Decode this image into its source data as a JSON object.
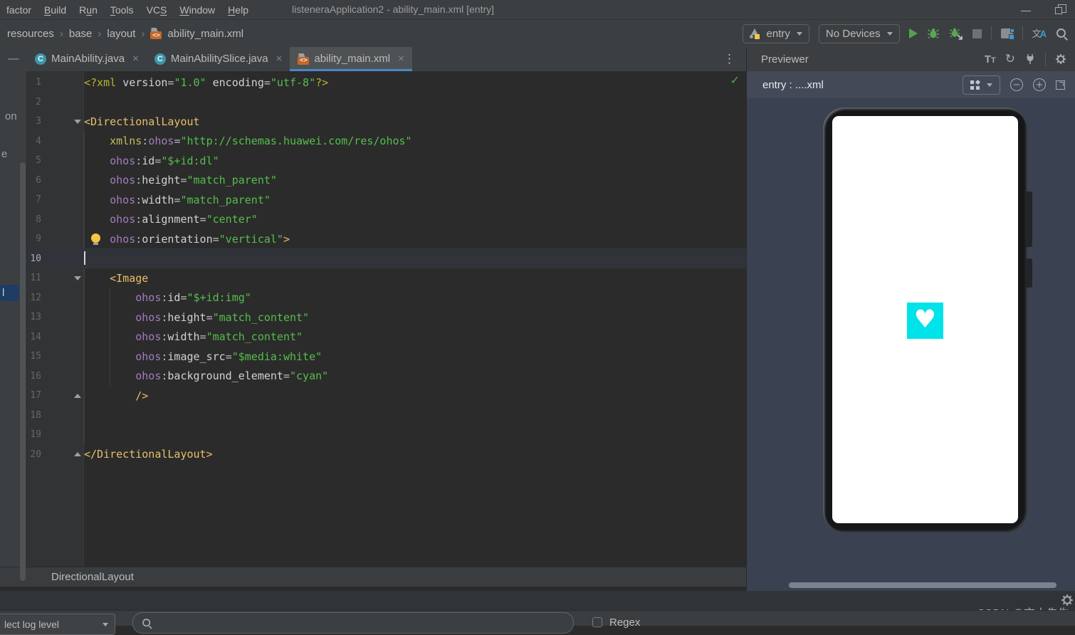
{
  "window": {
    "title": "listeneraApplication2 - ability_main.xml [entry]"
  },
  "menu": {
    "items": [
      {
        "label": "factor",
        "u": null
      },
      {
        "label": "Build",
        "u": 0
      },
      {
        "label": "Run",
        "u": 1
      },
      {
        "label": "Tools",
        "u": 0
      },
      {
        "label": "VCS",
        "u": 2
      },
      {
        "label": "Window",
        "u": 0
      },
      {
        "label": "Help",
        "u": 0
      }
    ]
  },
  "navbar": {
    "breadcrumbs": [
      "resources",
      "base",
      "layout"
    ],
    "file": "ability_main.xml",
    "run_config": "entry",
    "device": "No Devices"
  },
  "tabs": [
    {
      "label": "MainAbility.java",
      "icon": "java",
      "active": false
    },
    {
      "label": "MainAbilitySlice.java",
      "icon": "java",
      "active": false
    },
    {
      "label": "ability_main.xml",
      "icon": "xml",
      "active": true
    }
  ],
  "editor": {
    "breadcrumb": "DirectionalLayout",
    "lines": [
      {
        "n": 1,
        "t": [
          [
            "pi",
            "<?xml "
          ],
          [
            "attr",
            "version"
          ],
          [
            "eq",
            "="
          ],
          [
            "str",
            "\"1.0\""
          ],
          [
            "pl",
            " "
          ],
          [
            "attr",
            "encoding"
          ],
          [
            "eq",
            "="
          ],
          [
            "str",
            "\"utf-8\""
          ],
          [
            "pi",
            "?>"
          ]
        ]
      },
      {
        "n": 2,
        "t": []
      },
      {
        "n": 3,
        "fold": "open",
        "t": [
          [
            "tag",
            "<DirectionalLayout"
          ]
        ]
      },
      {
        "n": 4,
        "t": [
          [
            "pl",
            "    "
          ],
          [
            "kw",
            "xmlns"
          ],
          [
            "eq",
            ":"
          ],
          [
            "ns",
            "ohos"
          ],
          [
            "eq",
            "="
          ],
          [
            "str",
            "\"http://schemas.huawei.com/res/ohos\""
          ]
        ]
      },
      {
        "n": 5,
        "t": [
          [
            "pl",
            "    "
          ],
          [
            "ns",
            "ohos"
          ],
          [
            "eq",
            ":"
          ],
          [
            "attr",
            "id"
          ],
          [
            "eq",
            "="
          ],
          [
            "str",
            "\"$+id:dl\""
          ]
        ]
      },
      {
        "n": 6,
        "t": [
          [
            "pl",
            "    "
          ],
          [
            "ns",
            "ohos"
          ],
          [
            "eq",
            ":"
          ],
          [
            "attr",
            "height"
          ],
          [
            "eq",
            "="
          ],
          [
            "str",
            "\"match_parent\""
          ]
        ]
      },
      {
        "n": 7,
        "t": [
          [
            "pl",
            "    "
          ],
          [
            "ns",
            "ohos"
          ],
          [
            "eq",
            ":"
          ],
          [
            "attr",
            "width"
          ],
          [
            "eq",
            "="
          ],
          [
            "str",
            "\"match_parent\""
          ]
        ]
      },
      {
        "n": 8,
        "t": [
          [
            "pl",
            "    "
          ],
          [
            "ns",
            "ohos"
          ],
          [
            "eq",
            ":"
          ],
          [
            "attr",
            "alignment"
          ],
          [
            "eq",
            "="
          ],
          [
            "str",
            "\"center\""
          ]
        ]
      },
      {
        "n": 9,
        "bulb": true,
        "t": [
          [
            "pl",
            "    "
          ],
          [
            "ns",
            "ohos"
          ],
          [
            "eq",
            ":"
          ],
          [
            "attr",
            "orientation"
          ],
          [
            "eq",
            "="
          ],
          [
            "str",
            "\"vertical\""
          ],
          [
            "tag",
            ">"
          ]
        ]
      },
      {
        "n": 10,
        "current": true,
        "caret": true,
        "t": []
      },
      {
        "n": 11,
        "fold": "open",
        "t": [
          [
            "pl",
            "    "
          ],
          [
            "tag",
            "<Image"
          ]
        ]
      },
      {
        "n": 12,
        "t": [
          [
            "pl",
            "        "
          ],
          [
            "ns",
            "ohos"
          ],
          [
            "eq",
            ":"
          ],
          [
            "attr",
            "id"
          ],
          [
            "eq",
            "="
          ],
          [
            "str",
            "\"$+id:img\""
          ]
        ]
      },
      {
        "n": 13,
        "t": [
          [
            "pl",
            "        "
          ],
          [
            "ns",
            "ohos"
          ],
          [
            "eq",
            ":"
          ],
          [
            "attr",
            "height"
          ],
          [
            "eq",
            "="
          ],
          [
            "str",
            "\"match_content\""
          ]
        ]
      },
      {
        "n": 14,
        "t": [
          [
            "pl",
            "        "
          ],
          [
            "ns",
            "ohos"
          ],
          [
            "eq",
            ":"
          ],
          [
            "attr",
            "width"
          ],
          [
            "eq",
            "="
          ],
          [
            "str",
            "\"match_content\""
          ]
        ]
      },
      {
        "n": 15,
        "t": [
          [
            "pl",
            "        "
          ],
          [
            "ns",
            "ohos"
          ],
          [
            "eq",
            ":"
          ],
          [
            "attr",
            "image_src"
          ],
          [
            "eq",
            "="
          ],
          [
            "str",
            "\"$media:white\""
          ]
        ]
      },
      {
        "n": 16,
        "t": [
          [
            "pl",
            "        "
          ],
          [
            "ns",
            "ohos"
          ],
          [
            "eq",
            ":"
          ],
          [
            "attr",
            "background_element"
          ],
          [
            "eq",
            "="
          ],
          [
            "str",
            "\"cyan\""
          ]
        ]
      },
      {
        "n": 17,
        "fold": "close",
        "t": [
          [
            "pl",
            "        "
          ],
          [
            "tag",
            "/>"
          ]
        ]
      },
      {
        "n": 18,
        "t": []
      },
      {
        "n": 19,
        "t": []
      },
      {
        "n": 20,
        "fold": "close",
        "t": [
          [
            "tag",
            "</DirectionalLayout>"
          ]
        ]
      }
    ]
  },
  "sliver": {
    "fragments": [
      "on",
      "e"
    ],
    "selected_fragment": "l"
  },
  "previewer": {
    "panel_title": "Previewer",
    "target": "entry : ....xml"
  },
  "bottom": {
    "log_level": "lect log level",
    "regex": "Regex"
  },
  "watermark": "CSDN @吉士先生",
  "icons": {
    "kebab": "⋮",
    "tab_strip_hide": "—",
    "minimize": "—",
    "close_tab": "×",
    "check": "✓",
    "refresh": "↻",
    "heart": "♥",
    "crumb_sep": "›",
    "xml_glyph": "<>",
    "java_glyph": "C",
    "zoom_in": "+",
    "zoom_out": "−",
    "font_big": "T",
    "font_small": "T",
    "translate_zh": "文",
    "translate_en": "A"
  },
  "colors": {
    "tab_accent": "#4A88C7",
    "element_cyan": "#00E3E9",
    "string_green": "#55BE4B",
    "tag_yellow": "#E8BF6A",
    "ns_purple": "#A27BC0",
    "run_green": "#4DA54D",
    "bug_green": "#5BA653"
  }
}
